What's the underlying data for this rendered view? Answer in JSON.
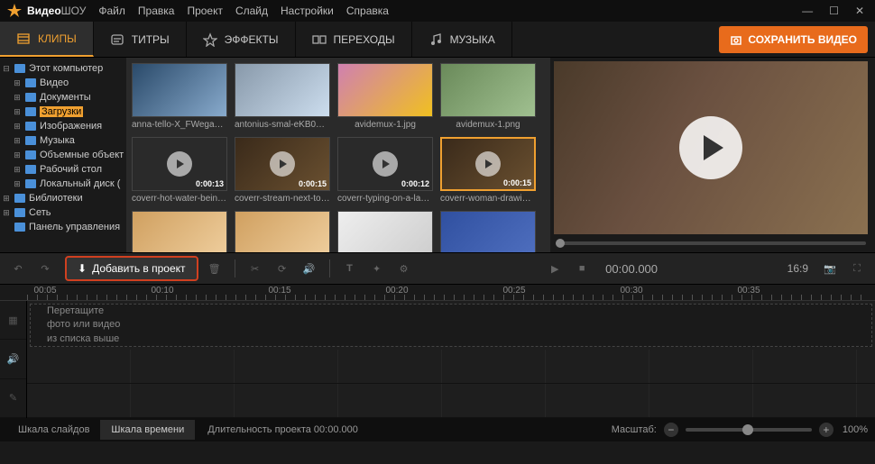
{
  "app": {
    "title_a": "Видео",
    "title_b": "ШОУ"
  },
  "menu": [
    "Файл",
    "Правка",
    "Проект",
    "Слайд",
    "Настройки",
    "Справка"
  ],
  "tabs": [
    {
      "label": "КЛИПЫ",
      "active": true
    },
    {
      "label": "ТИТРЫ",
      "active": false
    },
    {
      "label": "ЭФФЕКТЫ",
      "active": false
    },
    {
      "label": "ПЕРЕХОДЫ",
      "active": false
    },
    {
      "label": "МУЗЫКА",
      "active": false
    }
  ],
  "save_button": "СОХРАНИТЬ ВИДЕО",
  "tree": [
    {
      "label": "Этот компьютер",
      "level": 0,
      "exp": "-",
      "icon": "pc"
    },
    {
      "label": "Видео",
      "level": 1,
      "exp": "+",
      "icon": "folder"
    },
    {
      "label": "Документы",
      "level": 1,
      "exp": "+",
      "icon": "folder"
    },
    {
      "label": "Загрузки",
      "level": 1,
      "exp": "+",
      "icon": "folder",
      "selected": true
    },
    {
      "label": "Изображения",
      "level": 1,
      "exp": "+",
      "icon": "folder"
    },
    {
      "label": "Музыка",
      "level": 1,
      "exp": "+",
      "icon": "folder"
    },
    {
      "label": "Объемные объект",
      "level": 1,
      "exp": "+",
      "icon": "folder"
    },
    {
      "label": "Рабочий стол",
      "level": 1,
      "exp": "+",
      "icon": "folder"
    },
    {
      "label": "Локальный диск (",
      "level": 1,
      "exp": "+",
      "icon": "folder"
    },
    {
      "label": "Библиотеки",
      "level": 0,
      "exp": "+",
      "icon": "folder"
    },
    {
      "label": "Сеть",
      "level": 0,
      "exp": "+",
      "icon": "pc"
    },
    {
      "label": "Панель управления",
      "level": 0,
      "exp": "",
      "icon": "folder"
    }
  ],
  "thumbs": [
    {
      "name": "anna-tello-X_FWega1EU0-…",
      "dur": "",
      "bg": "bg1"
    },
    {
      "name": "antonius-smal-eKB0NmlUe…",
      "dur": "",
      "bg": "bg2"
    },
    {
      "name": "avidemux-1.jpg",
      "dur": "",
      "bg": "bg3"
    },
    {
      "name": "avidemux-1.png",
      "dur": "",
      "bg": "bg4"
    },
    {
      "name": "coverr-hot-water-being-p…",
      "dur": "0:00:13",
      "bg": "bg5",
      "video": true
    },
    {
      "name": "coverr-stream-next-to-the…",
      "dur": "0:00:15",
      "bg": "bg6",
      "video": true
    },
    {
      "name": "coverr-typing-on-a-laptop…",
      "dur": "0:00:12",
      "bg": "bg5",
      "video": true
    },
    {
      "name": "coverr-woman-drawing-in-…",
      "dur": "0:00:15",
      "bg": "bg6",
      "video": true,
      "selected": true
    },
    {
      "name": "",
      "dur": "",
      "bg": "bg7"
    },
    {
      "name": "",
      "dur": "",
      "bg": "bg7"
    },
    {
      "name": "",
      "dur": "",
      "bg": "bg8"
    },
    {
      "name": "",
      "dur": "",
      "bg": "bg9"
    }
  ],
  "toolbar": {
    "add_label": "Добавить в проект",
    "timecode": "00:00.000",
    "aspect": "16:9"
  },
  "ruler": [
    "00:05",
    "00:10",
    "00:15",
    "00:20",
    "00:25",
    "00:30",
    "00:35"
  ],
  "placeholder_lines": [
    "Перетащите",
    "фото или видео",
    "из списка выше"
  ],
  "statusbar": {
    "tab_slides": "Шкала слайдов",
    "tab_time": "Шкала времени",
    "duration_label": "Длительность проекта",
    "duration_value": "00:00.000",
    "zoom_label": "Масштаб:",
    "zoom_value": "100%"
  }
}
